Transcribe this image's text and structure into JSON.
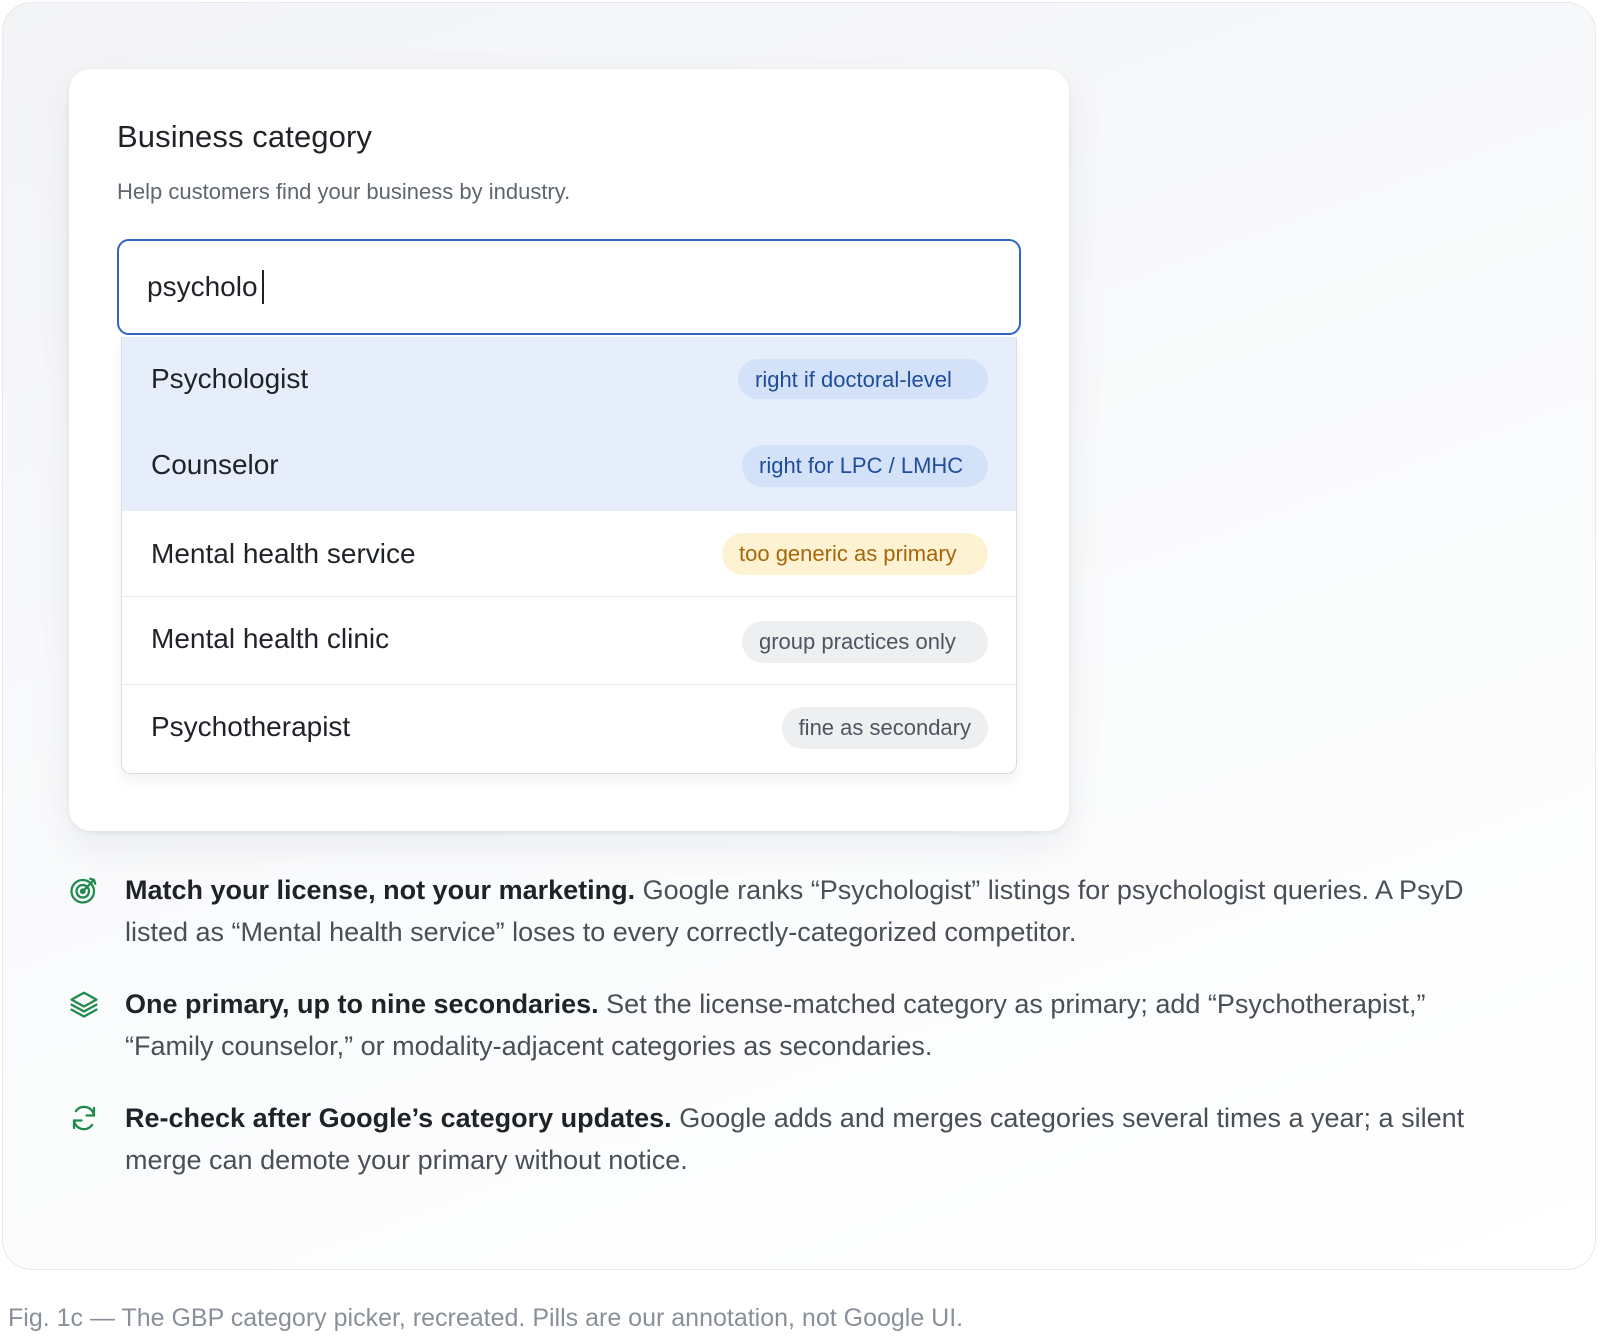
{
  "card": {
    "title": "Business category",
    "subtitle": "Help customers find your business by industry."
  },
  "search": {
    "value": "psycholo"
  },
  "options": [
    {
      "label": "Psychologist",
      "pill": "right if doctoral-level",
      "pill_style": "blue",
      "highlighted": true
    },
    {
      "label": "Counselor",
      "pill": "right for LPC / LMHC",
      "pill_style": "blue",
      "highlighted": true
    },
    {
      "label": "Mental health service",
      "pill": "too generic as primary",
      "pill_style": "yellow",
      "highlighted": false
    },
    {
      "label": "Mental health clinic",
      "pill": "group practices only",
      "pill_style": "gray",
      "highlighted": false
    },
    {
      "label": "Psychotherapist",
      "pill": "fine as secondary",
      "pill_style": "gray",
      "highlighted": false
    }
  ],
  "notes": [
    {
      "icon": "target-icon",
      "title": "Match your license, not your marketing.",
      "body": "Google ranks “Psychologist” listings for psychologist queries. A PsyD listed as “Mental health service” loses to every correctly-categorized competitor."
    },
    {
      "icon": "layers-icon",
      "title": "One primary, up to nine secondaries.",
      "body": "Set the license-matched category as primary; add “Psychotherapist,” “Family counselor,” or modality-adjacent categories as secondaries."
    },
    {
      "icon": "refresh-icon",
      "title": "Re-check after Google’s category updates.",
      "body": "Google adds and merges categories several times a year; a silent merge can demote your primary without notice."
    }
  ],
  "caption": "Fig. 1c — The GBP category picker, recreated. Pills are our annotation, not Google UI.",
  "colors": {
    "accent_blue": "#2f66c4",
    "highlight_bg": "#e6eefb",
    "icon_green": "#1f8a4c",
    "pill_blue_bg": "#d3e2f9",
    "pill_yellow_bg": "#fdf3d2",
    "pill_gray_bg": "#eeeff1"
  }
}
